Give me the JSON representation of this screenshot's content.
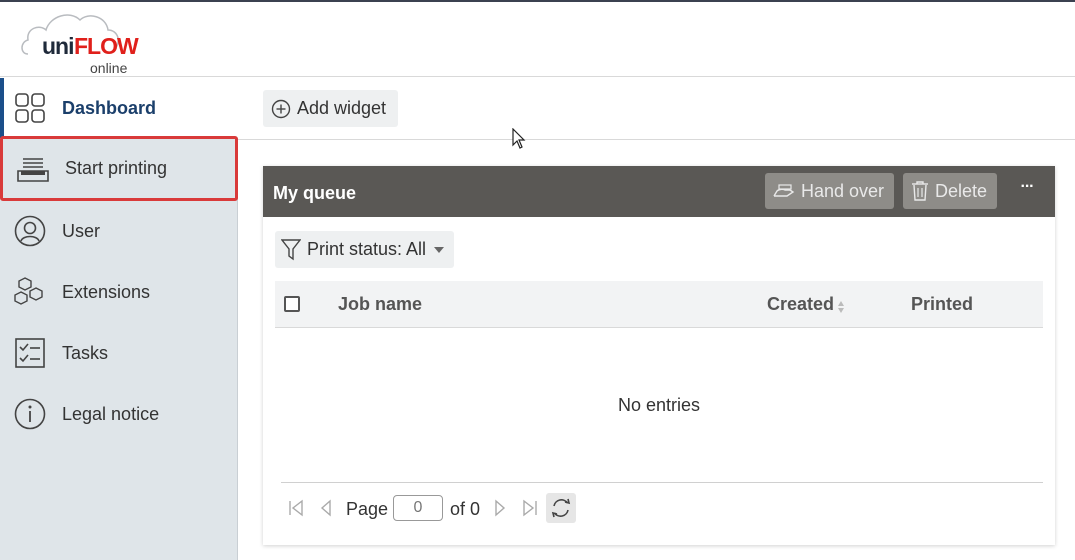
{
  "logo": {
    "uni": "uni",
    "flow": "FLOW",
    "online": "online"
  },
  "sidebar": {
    "items": [
      {
        "label": "Dashboard",
        "icon": "grid-icon",
        "active": true
      },
      {
        "label": "Start printing",
        "icon": "printer-tray-icon",
        "highlighted": true
      },
      {
        "label": "User",
        "icon": "user-icon"
      },
      {
        "label": "Extensions",
        "icon": "cubes-icon"
      },
      {
        "label": "Tasks",
        "icon": "checklist-icon"
      },
      {
        "label": "Legal notice",
        "icon": "info-icon"
      }
    ]
  },
  "toolbar": {
    "add_widget_label": "Add widget"
  },
  "widget": {
    "title": "My queue",
    "hand_over_label": "Hand over",
    "delete_label": "Delete",
    "more_label": "···",
    "filter_label": "Print status: All",
    "columns": {
      "job_name": "Job name",
      "created": "Created",
      "printed": "Printed"
    },
    "empty_text": "No entries",
    "pager": {
      "page_label": "Page",
      "page_value": "0",
      "of_label": "of 0"
    }
  },
  "colors": {
    "accent": "#1b4f8a",
    "highlight": "#d93a3a",
    "widget_header": "#5a5855"
  }
}
